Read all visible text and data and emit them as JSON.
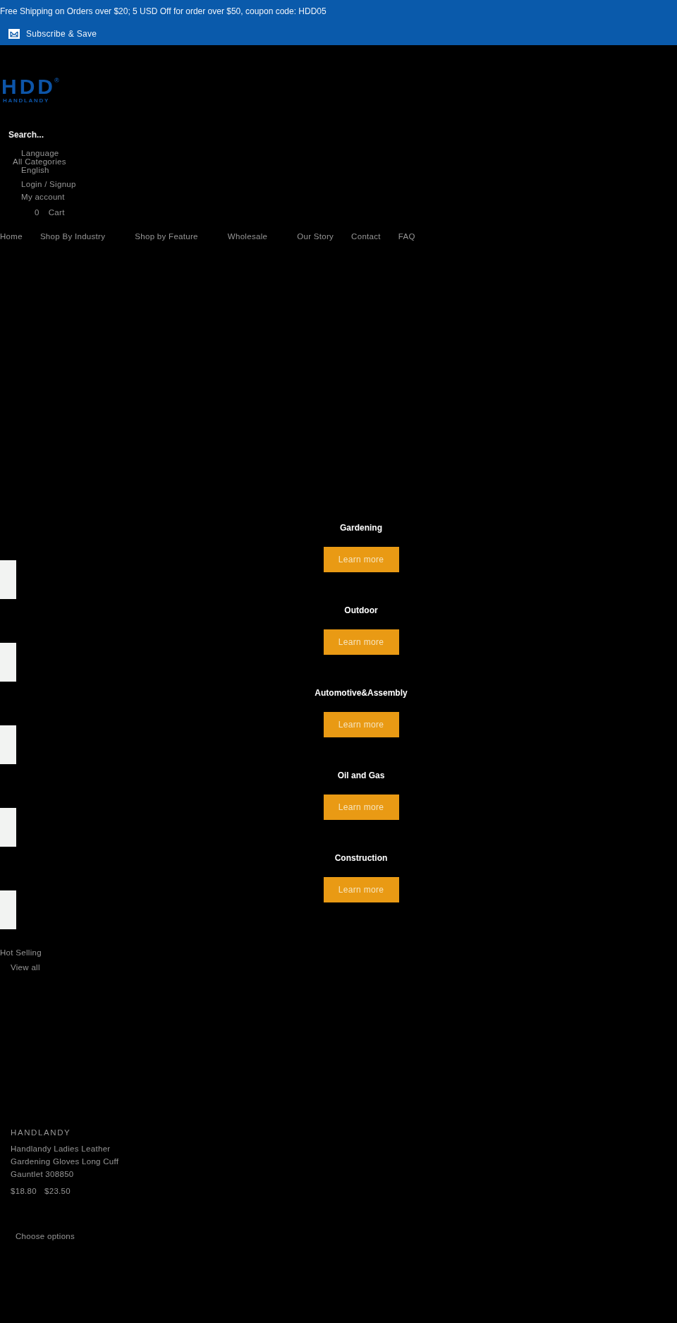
{
  "announcement_bar": {
    "message": "Free Shipping on Orders over $20; 5 USD Off for order over $50, coupon code: HDD05",
    "subscribe": "Subscribe & Save"
  },
  "header": {
    "logo": {
      "mark": "HDD",
      "registered": "®",
      "name": "HANDLANDY"
    },
    "search": {
      "placeholder": "Search..."
    },
    "language": {
      "label": "Language",
      "value": "English"
    },
    "category_select": "All Categories",
    "account": {
      "login": "Login / Signup",
      "my_account": "My account"
    },
    "cart": {
      "count": "0",
      "label": "Cart"
    }
  },
  "nav": [
    {
      "label": "Home"
    },
    {
      "label": "Shop By Industry"
    },
    {
      "label": "Shop by Feature"
    },
    {
      "label": "Wholesale"
    },
    {
      "label": "Our Story"
    },
    {
      "label": "Contact"
    },
    {
      "label": "FAQ"
    }
  ],
  "collections": [
    {
      "title": "Gardening",
      "button": "Learn more"
    },
    {
      "title": "Outdoor",
      "button": "Learn more"
    },
    {
      "title": "Automotive&Assembly",
      "button": "Learn more"
    },
    {
      "title": "Oil and Gas",
      "button": "Learn more"
    },
    {
      "title": "Construction",
      "button": "Learn more"
    }
  ],
  "hot_selling": {
    "title": "Hot Selling",
    "view_all": "View all",
    "products": [
      {
        "vendor": "HANDLANDY",
        "title": "Handlandy Ladies Leather Gardening Gloves Long Cuff Gauntlet 308850",
        "price": "$18.80",
        "compare_price": "$23.50",
        "button": "Choose options"
      }
    ]
  }
}
